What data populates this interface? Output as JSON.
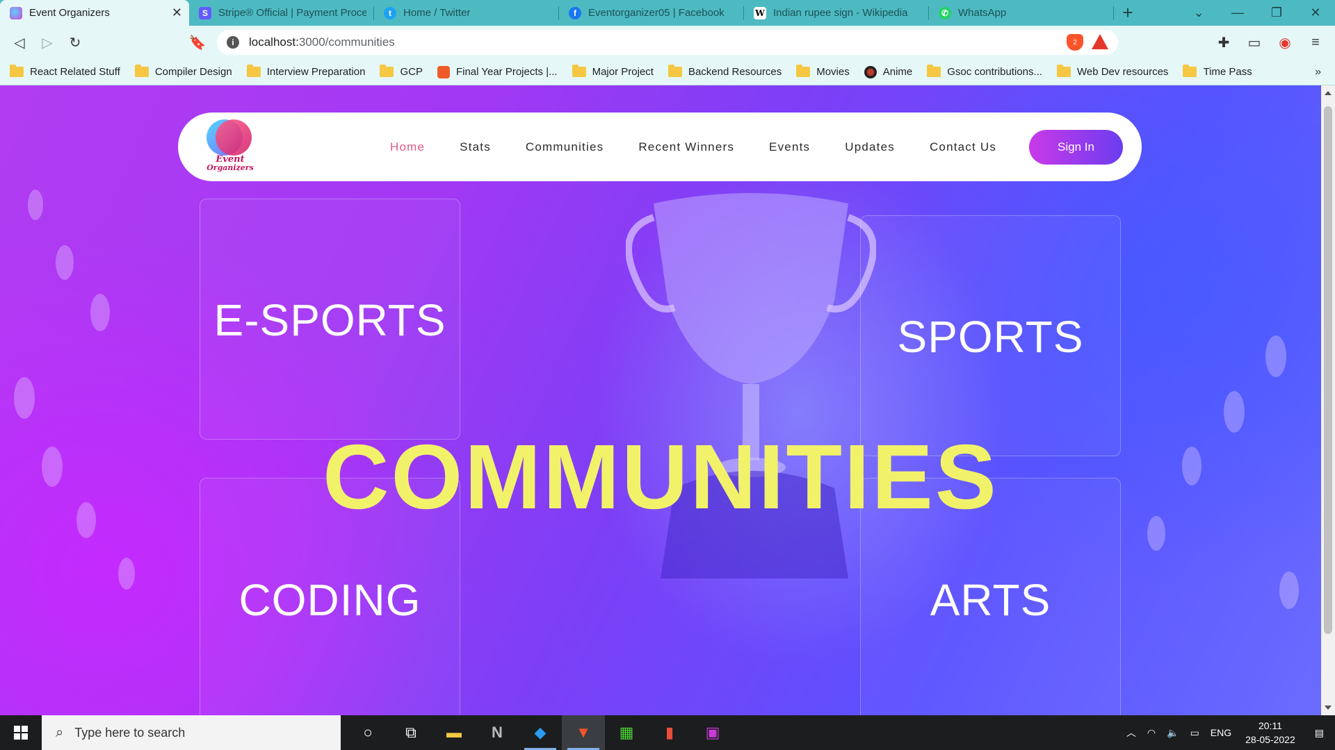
{
  "browser": {
    "tabs": [
      {
        "title": "Event Organizers",
        "favicon_color": "#c94ad6"
      },
      {
        "title": "Stripe® Official | Payment Proces",
        "favicon_color": "#635bff"
      },
      {
        "title": "Home / Twitter",
        "favicon_color": "#1da1f2"
      },
      {
        "title": "Eventorganizer05 | Facebook",
        "favicon_color": "#1877f2"
      },
      {
        "title": "Indian rupee sign - Wikipedia",
        "favicon_color": "#ffffff"
      },
      {
        "title": "WhatsApp",
        "favicon_color": "#25d366"
      }
    ],
    "url_host": "localhost:",
    "url_path": "3000/communities",
    "bookmarks": [
      "React Related Stuff",
      "Compiler Design",
      "Interview Preparation",
      "GCP",
      "Final Year Projects |...",
      "Major Project",
      "Backend Resources",
      "Movies",
      "Anime",
      "Gsoc contributions...",
      "Web Dev resources",
      "Time Pass"
    ],
    "brave_badge": "2"
  },
  "site": {
    "logo_text_line1": "Event",
    "logo_text_line2": "Organizers",
    "nav": {
      "home": "Home",
      "stats": "Stats",
      "communities": "Communities",
      "recent_winners": "Recent Winners",
      "events": "Events",
      "updates": "Updates",
      "contact": "Contact Us",
      "sign_in": "Sign In"
    },
    "headline": "COMMUNITIES",
    "cards": {
      "esports": "E-SPORTS",
      "sports": "SPORTS",
      "coding": "CODING",
      "arts": "ARTS"
    },
    "colors": {
      "headline": "#f2f26a",
      "nav_active": "#e05a88",
      "signin_start": "#c93ae8",
      "signin_end": "#6b3cf0"
    }
  },
  "taskbar": {
    "search_placeholder": "Type here to search",
    "language": "ENG",
    "time": "20:11",
    "date": "28-05-2022"
  }
}
